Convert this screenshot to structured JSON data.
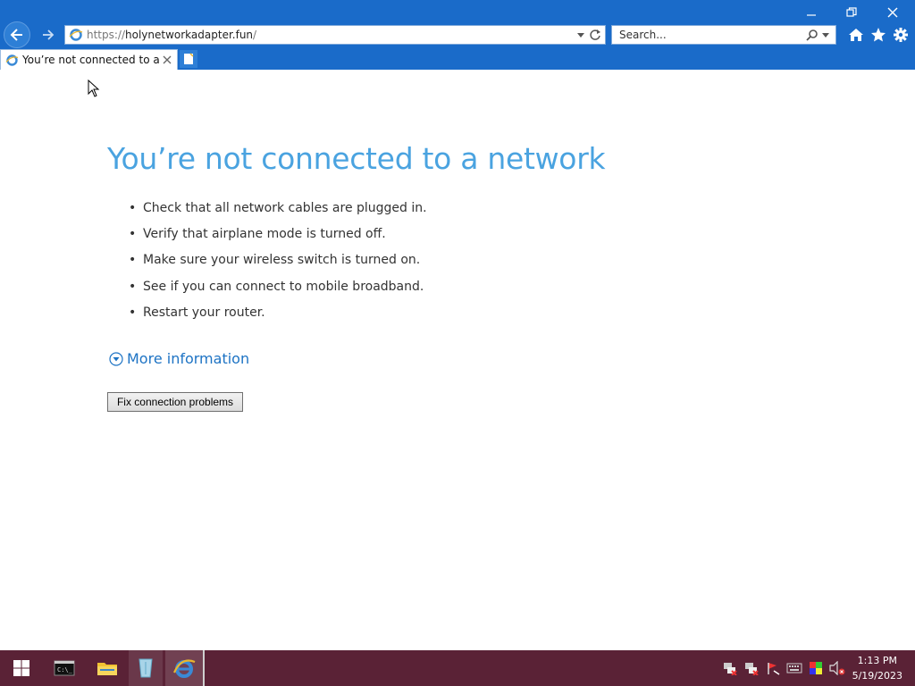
{
  "window": {
    "controls": {
      "minimize": "minimize-icon",
      "restore": "restore-icon",
      "close": "close-icon"
    }
  },
  "navigation": {
    "back_icon": "back-arrow-icon",
    "forward_icon": "forward-arrow-icon"
  },
  "address_bar": {
    "url_prefix": "https://",
    "url_host": "holynetworkadapter.fun",
    "url_suffix": "/"
  },
  "search": {
    "placeholder": "Search..."
  },
  "toolbar": {
    "icons": [
      "home-icon",
      "favorites-star-icon",
      "settings-gear-icon"
    ]
  },
  "tabs": [
    {
      "label": "You’re not connected to a n...",
      "active": true
    }
  ],
  "page": {
    "heading": "You’re not connected to a network",
    "tips": [
      "Check that all network cables are plugged in.",
      "Verify that airplane mode is turned off.",
      "Make sure your wireless switch is turned on.",
      "See if you can connect to mobile broadband.",
      "Restart your router."
    ],
    "more_info_label": "More information",
    "fix_button_label": "Fix connection problems"
  },
  "taskbar": {
    "apps": [
      "start",
      "command-prompt",
      "file-explorer",
      "recycle-bin",
      "internet-explorer"
    ],
    "clock": {
      "time": "1:13 PM",
      "date": "5/19/2023"
    }
  },
  "colors": {
    "chrome_blue": "#1a6bc9",
    "heading_blue": "#4aa3e0",
    "link_blue": "#1d73c4",
    "taskbar": "#5a2236"
  }
}
